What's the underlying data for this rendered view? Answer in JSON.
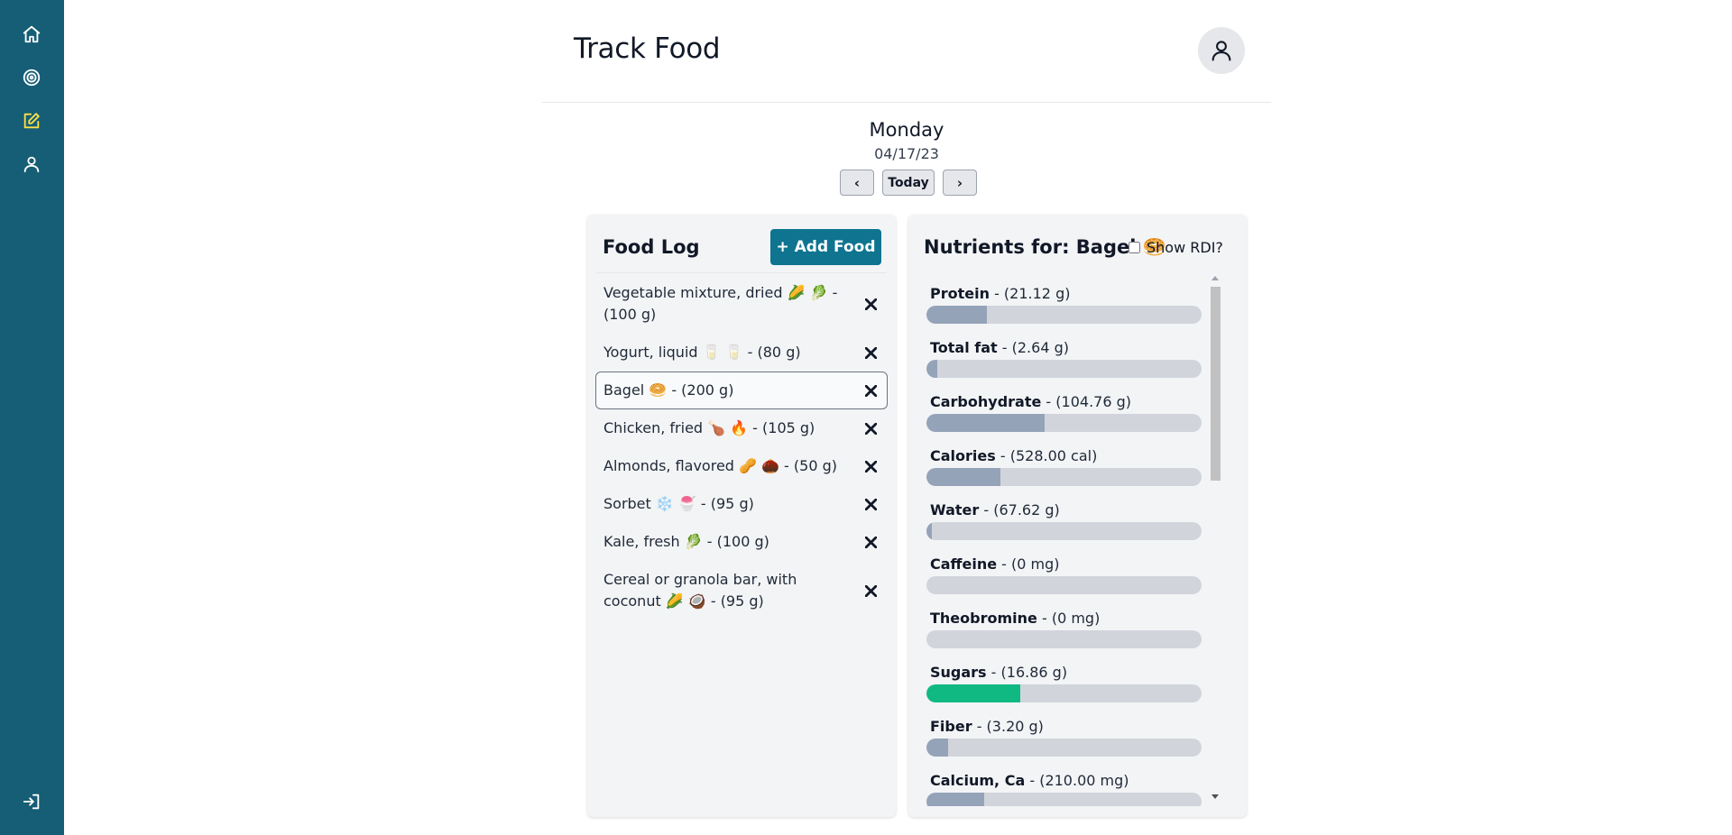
{
  "sidebar": {
    "items": [
      {
        "name": "home-icon"
      },
      {
        "name": "target-icon"
      },
      {
        "name": "edit-icon",
        "active": true
      },
      {
        "name": "user-icon"
      },
      {
        "name": "logout-icon"
      }
    ],
    "active_color": "#fde047",
    "background": "#155e75"
  },
  "header": {
    "title": "Track Food"
  },
  "day": {
    "name": "Monday",
    "date": "04/17/23",
    "prev_label": "‹",
    "today_label": "Today",
    "next_label": "›"
  },
  "food_log": {
    "title": "Food Log",
    "add_label": "+ Add Food",
    "items": [
      {
        "label": "Vegetable mixture, dried 🌽 🥬 - (100 g)",
        "selected": false
      },
      {
        "label": "Yogurt, liquid 🥛 🥛 - (80 g)",
        "selected": false
      },
      {
        "label": "Bagel 🥯 - (200 g)",
        "selected": true
      },
      {
        "label": "Chicken, fried 🍗 🔥 - (105 g)",
        "selected": false
      },
      {
        "label": "Almonds, flavored 🥜 🌰 - (50 g)",
        "selected": false
      },
      {
        "label": "Sorbet ❄️ 🍧 - (95 g)",
        "selected": false
      },
      {
        "label": "Kale, fresh 🥬 - (100 g)",
        "selected": false
      },
      {
        "label": "Cereal or granola bar, with coconut 🌽 🥥 - (95 g)",
        "selected": false
      }
    ]
  },
  "nutrients": {
    "title": "Nutrients for: Bagel 🥯",
    "show_rdi_label": "Show RDI?",
    "show_rdi_checked": false,
    "items": [
      {
        "name": "Protein",
        "amount": " - (21.12 g)",
        "fill": 0.22,
        "color": "#94a3b8"
      },
      {
        "name": "Total fat",
        "amount": " - (2.64 g)",
        "fill": 0.04,
        "color": "#94a3b8"
      },
      {
        "name": "Carbohydrate",
        "amount": " - (104.76 g)",
        "fill": 0.43,
        "color": "#94a3b8"
      },
      {
        "name": "Calories",
        "amount": " - (528.00 cal)",
        "fill": 0.27,
        "color": "#94a3b8"
      },
      {
        "name": "Water",
        "amount": " - (67.62 g)",
        "fill": 0.02,
        "color": "#94a3b8"
      },
      {
        "name": "Caffeine",
        "amount": " - (0 mg)",
        "fill": 0,
        "color": "#94a3b8"
      },
      {
        "name": "Theobromine",
        "amount": " - (0 mg)",
        "fill": 0,
        "color": "#94a3b8"
      },
      {
        "name": "Sugars",
        "amount": " - (16.86 g)",
        "fill": 0.34,
        "color": "#10b981"
      },
      {
        "name": "Fiber",
        "amount": " - (3.20 g)",
        "fill": 0.08,
        "color": "#94a3b8"
      },
      {
        "name": "Calcium, Ca",
        "amount": " - (210.00 mg)",
        "fill": 0.21,
        "color": "#94a3b8"
      }
    ]
  }
}
